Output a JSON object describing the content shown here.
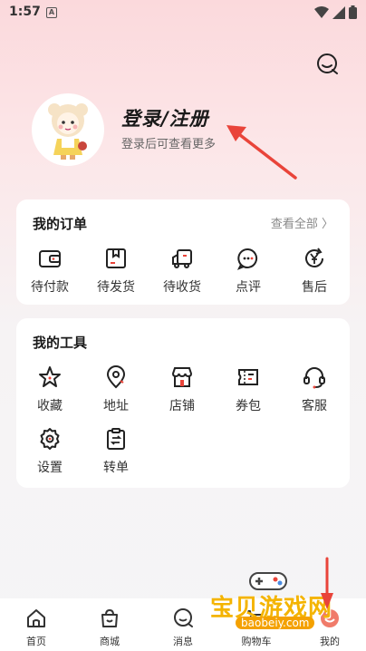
{
  "status_bar": {
    "time": "1:57",
    "a_label": "A"
  },
  "profile": {
    "title": "登录/注册",
    "subtitle": "登录后可查看更多"
  },
  "orders": {
    "title": "我的订单",
    "view_all": "查看全部 〉",
    "items": [
      {
        "label": "待付款",
        "icon": "wallet-icon"
      },
      {
        "label": "待发货",
        "icon": "package-icon"
      },
      {
        "label": "待收货",
        "icon": "truck-icon"
      },
      {
        "label": "点评",
        "icon": "comment-icon"
      },
      {
        "label": "售后",
        "icon": "yen-refresh-icon"
      }
    ]
  },
  "tools": {
    "title": "我的工具",
    "items": [
      {
        "label": "收藏",
        "icon": "star-icon"
      },
      {
        "label": "地址",
        "icon": "location-icon"
      },
      {
        "label": "店铺",
        "icon": "store-icon"
      },
      {
        "label": "券包",
        "icon": "coupon-icon"
      },
      {
        "label": "客服",
        "icon": "headset-icon"
      },
      {
        "label": "设置",
        "icon": "gear-icon"
      },
      {
        "label": "转单",
        "icon": "clipboard-icon"
      }
    ]
  },
  "tabbar": {
    "items": [
      {
        "label": "首页",
        "icon": "home-icon"
      },
      {
        "label": "商城",
        "icon": "bag-icon"
      },
      {
        "label": "消息",
        "icon": "message-icon"
      },
      {
        "label": "购物车",
        "icon": "cart-icon"
      },
      {
        "label": "我的",
        "icon": "user-icon"
      }
    ]
  },
  "watermark": {
    "text": "宝贝游戏网",
    "url": "baobeiy.com"
  },
  "colors": {
    "accent": "#e9443a",
    "watermark": "#f4b400"
  }
}
